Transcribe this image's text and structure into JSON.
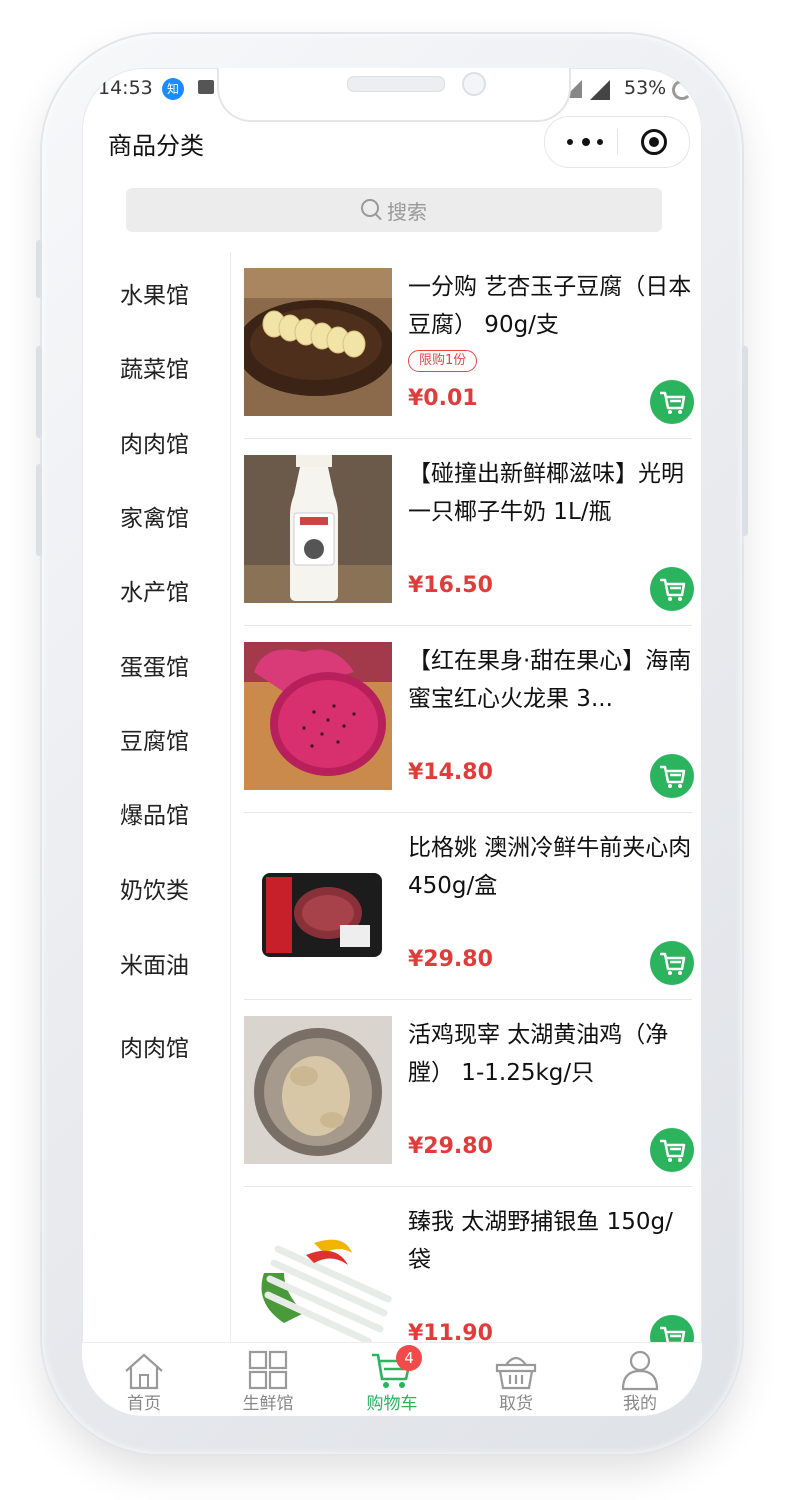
{
  "status_bar": {
    "time": "14:53",
    "app_badge": "知",
    "battery": "53%"
  },
  "nav": {
    "title": "商品分类",
    "more_icon": "more-dots-icon",
    "close_icon": "target-circle-icon"
  },
  "search": {
    "placeholder": "搜索",
    "icon": "search-icon"
  },
  "categories": [
    "水果馆",
    "蔬菜馆",
    "肉肉馆",
    "家禽馆",
    "水产馆",
    "蛋蛋馆",
    "豆腐馆",
    "爆品馆",
    "奶饮类",
    "米面油",
    "肉肉馆"
  ],
  "products": [
    {
      "name": "一分购 艺杏玉子豆腐（日本豆腐） 90g/支",
      "limit": "限购1份",
      "price": "¥0.01",
      "image": "tofu-on-plate"
    },
    {
      "name": "【碰撞出新鲜椰滋味】光明 一只椰子牛奶 1L/瓶",
      "limit": "",
      "price": "¥16.50",
      "image": "coconut-milk-bottle"
    },
    {
      "name": "【红在果身·甜在果心】海南蜜宝红心火龙果 3...",
      "limit": "",
      "price": "¥14.80",
      "image": "red-dragon-fruit"
    },
    {
      "name": "比格姚 澳洲冷鲜牛前夹心肉 450g/盒",
      "limit": "",
      "price": "¥29.80",
      "image": "beef-tray"
    },
    {
      "name": "活鸡现宰 太湖黄油鸡（净膛） 1-1.25kg/只",
      "limit": "",
      "price": "¥29.80",
      "image": "whole-chicken-bowl"
    },
    {
      "name": "臻我 太湖野捕银鱼 150g/袋",
      "limit": "",
      "price": "¥11.90",
      "image": "silver-fish"
    }
  ],
  "tabbar": {
    "items": [
      {
        "label": "首页",
        "icon": "home-icon",
        "active": false
      },
      {
        "label": "生鲜馆",
        "icon": "grid-icon",
        "active": false
      },
      {
        "label": "购物车",
        "icon": "cart-icon",
        "active": true,
        "badge": "4"
      },
      {
        "label": "取货",
        "icon": "basket-icon",
        "active": false
      },
      {
        "label": "我的",
        "icon": "user-icon",
        "active": false
      }
    ]
  },
  "colors": {
    "accent_green": "#2bb35d",
    "price_red": "#e03c3c",
    "badge_red": "#f24a4a"
  }
}
